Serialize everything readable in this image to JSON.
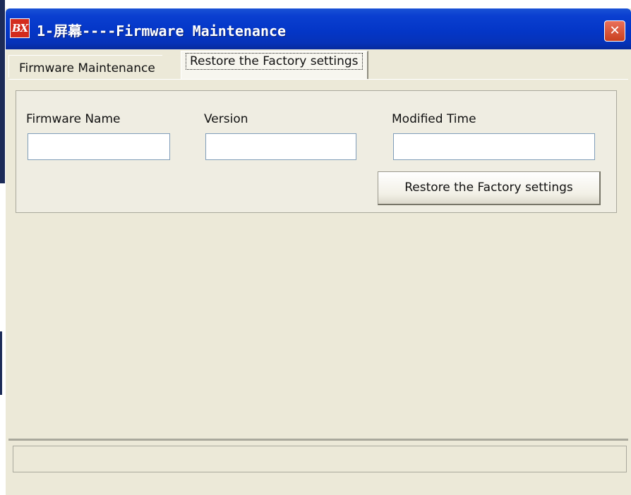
{
  "window": {
    "title": "1-屏幕----Firmware Maintenance",
    "app_icon_text": "BX",
    "close_glyph": "✕"
  },
  "tabs": [
    {
      "label": "Firmware Maintenance",
      "active": false
    },
    {
      "label": "Restore the Factory settings",
      "active": true
    }
  ],
  "panel": {
    "firmware_name_label": "Firmware Name",
    "firmware_name_value": "",
    "version_label": "Version",
    "version_value": "",
    "modified_time_label": "Modified Time",
    "modified_time_value": "",
    "restore_button_label": "Restore the Factory settings"
  },
  "status_bar": {
    "text": ""
  },
  "colors": {
    "titlebar": "#0436c7",
    "window_bg": "#ece9d8",
    "close_button": "#c9401f",
    "icon_red": "#d32b1d"
  }
}
